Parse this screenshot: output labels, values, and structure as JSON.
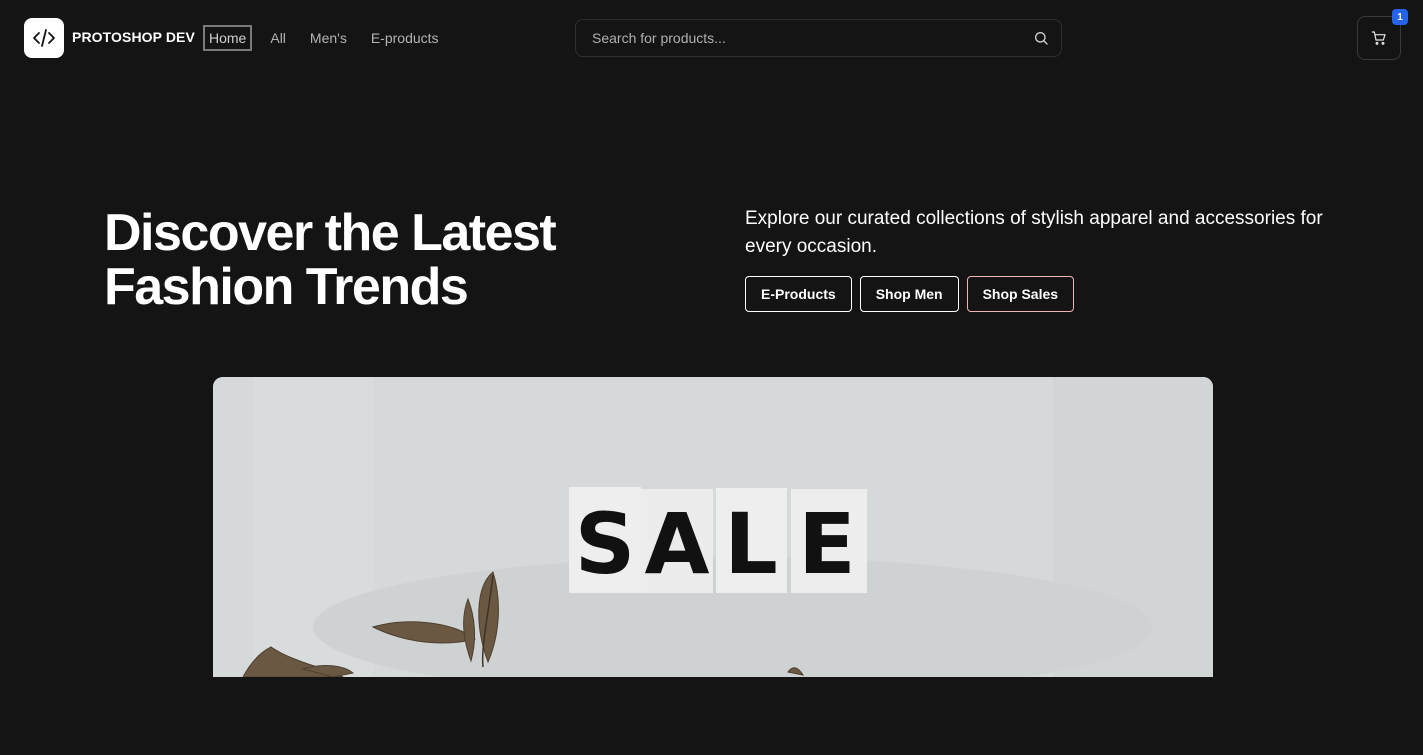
{
  "header": {
    "logo_icon": "code-brackets-icon",
    "brand": "PROTOSHOP DEV",
    "nav": [
      {
        "label": "Home",
        "active": true
      },
      {
        "label": "All",
        "active": false
      },
      {
        "label": "Men's",
        "active": false
      },
      {
        "label": "E-products",
        "active": false
      }
    ],
    "search": {
      "placeholder": "Search for products...",
      "value": "",
      "icon": "search-icon"
    },
    "cart": {
      "icon": "shopping-cart-icon",
      "count": "1",
      "badge_color": "#2563eb"
    }
  },
  "hero": {
    "title": "Discover the Latest Fashion Trends",
    "subtitle": "Explore our curated collections of stylish apparel and accessories for every occasion.",
    "buttons": [
      {
        "label": "E-Products"
      },
      {
        "label": "Shop Men"
      },
      {
        "label": "Shop Sales"
      }
    ]
  },
  "banner": {
    "sign_letters": [
      "S",
      "A",
      "L",
      "E"
    ]
  },
  "colors": {
    "background": "#141414",
    "text": "#ffffff",
    "nav_text": "#b3b3b3",
    "sale_button_border": "#f0b4b4"
  }
}
